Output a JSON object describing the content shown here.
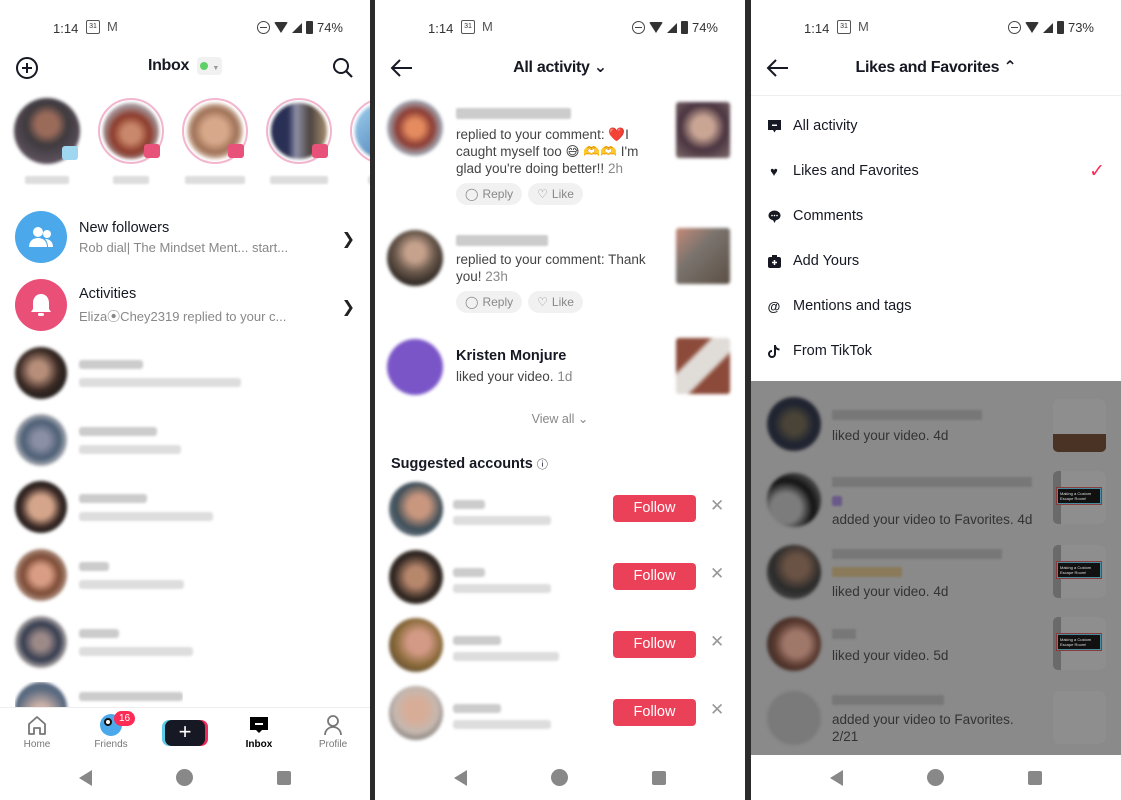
{
  "panels": [
    {
      "status": {
        "time": "1:14",
        "calendar_day": "31",
        "battery": "74%"
      },
      "header": {
        "title": "Inbox",
        "status_dot_color": "#5fd068"
      },
      "rows": [
        {
          "title": "New followers",
          "subtitle": "Rob dial| The Mindset Ment... start...",
          "color": "#4aa8eb"
        },
        {
          "title": "Activities",
          "subtitle": "Eliza⦿Chey2319 replied to your c...",
          "color": "#ea4f78"
        }
      ],
      "tabs": [
        {
          "label": "Home"
        },
        {
          "label": "Friends",
          "badge": "16"
        },
        {
          "label": ""
        },
        {
          "label": "Inbox"
        },
        {
          "label": "Profile"
        }
      ]
    },
    {
      "status": {
        "time": "1:14",
        "calendar_day": "31",
        "battery": "74%"
      },
      "header": {
        "title": "All activity ⌄"
      },
      "activities": [
        {
          "text": "replied to your comment: ❤️I caught myself too 😅 🫶🫶 I'm glad you're doing better!!",
          "time": "2h",
          "reply": "Reply",
          "like": "Like"
        },
        {
          "text": "replied to your comment: Thank you!",
          "time": "23h",
          "reply": "Reply",
          "like": "Like"
        },
        {
          "name": "Kristen Monjure",
          "text": "liked your video.",
          "time": "1d"
        }
      ],
      "view_all": "View all ⌄",
      "suggested_title": "Suggested accounts",
      "suggested": [
        {
          "button": "Follow"
        },
        {
          "button": "Follow"
        },
        {
          "button": "Follow"
        },
        {
          "button": "Follow"
        }
      ]
    },
    {
      "status": {
        "time": "1:14",
        "calendar_day": "31",
        "battery": "73%"
      },
      "header": {
        "title": "Likes and Favorites ⌃"
      },
      "menu": [
        {
          "label": "All activity",
          "icon": "message"
        },
        {
          "label": "Likes and Favorites",
          "icon": "heart",
          "selected": true
        },
        {
          "label": "Comments",
          "icon": "comment"
        },
        {
          "label": "Add Yours",
          "icon": "add-yours"
        },
        {
          "label": "Mentions and tags",
          "icon": "at"
        },
        {
          "label": "From TikTok",
          "icon": "tiktok"
        }
      ],
      "items": [
        {
          "text": "liked your video.",
          "time": "4d"
        },
        {
          "text": "added your video to Favorites.",
          "time": "4d"
        },
        {
          "text": "liked your video.",
          "time": "4d"
        },
        {
          "text": "liked your video.",
          "time": "5d"
        },
        {
          "text": "added your video to Favorites.",
          "time": "2/21"
        }
      ],
      "thumb_caption": "Making a Custom Escape Room!"
    }
  ],
  "colors": {
    "accent": "#fe2c55",
    "follow": "#ea4159"
  }
}
